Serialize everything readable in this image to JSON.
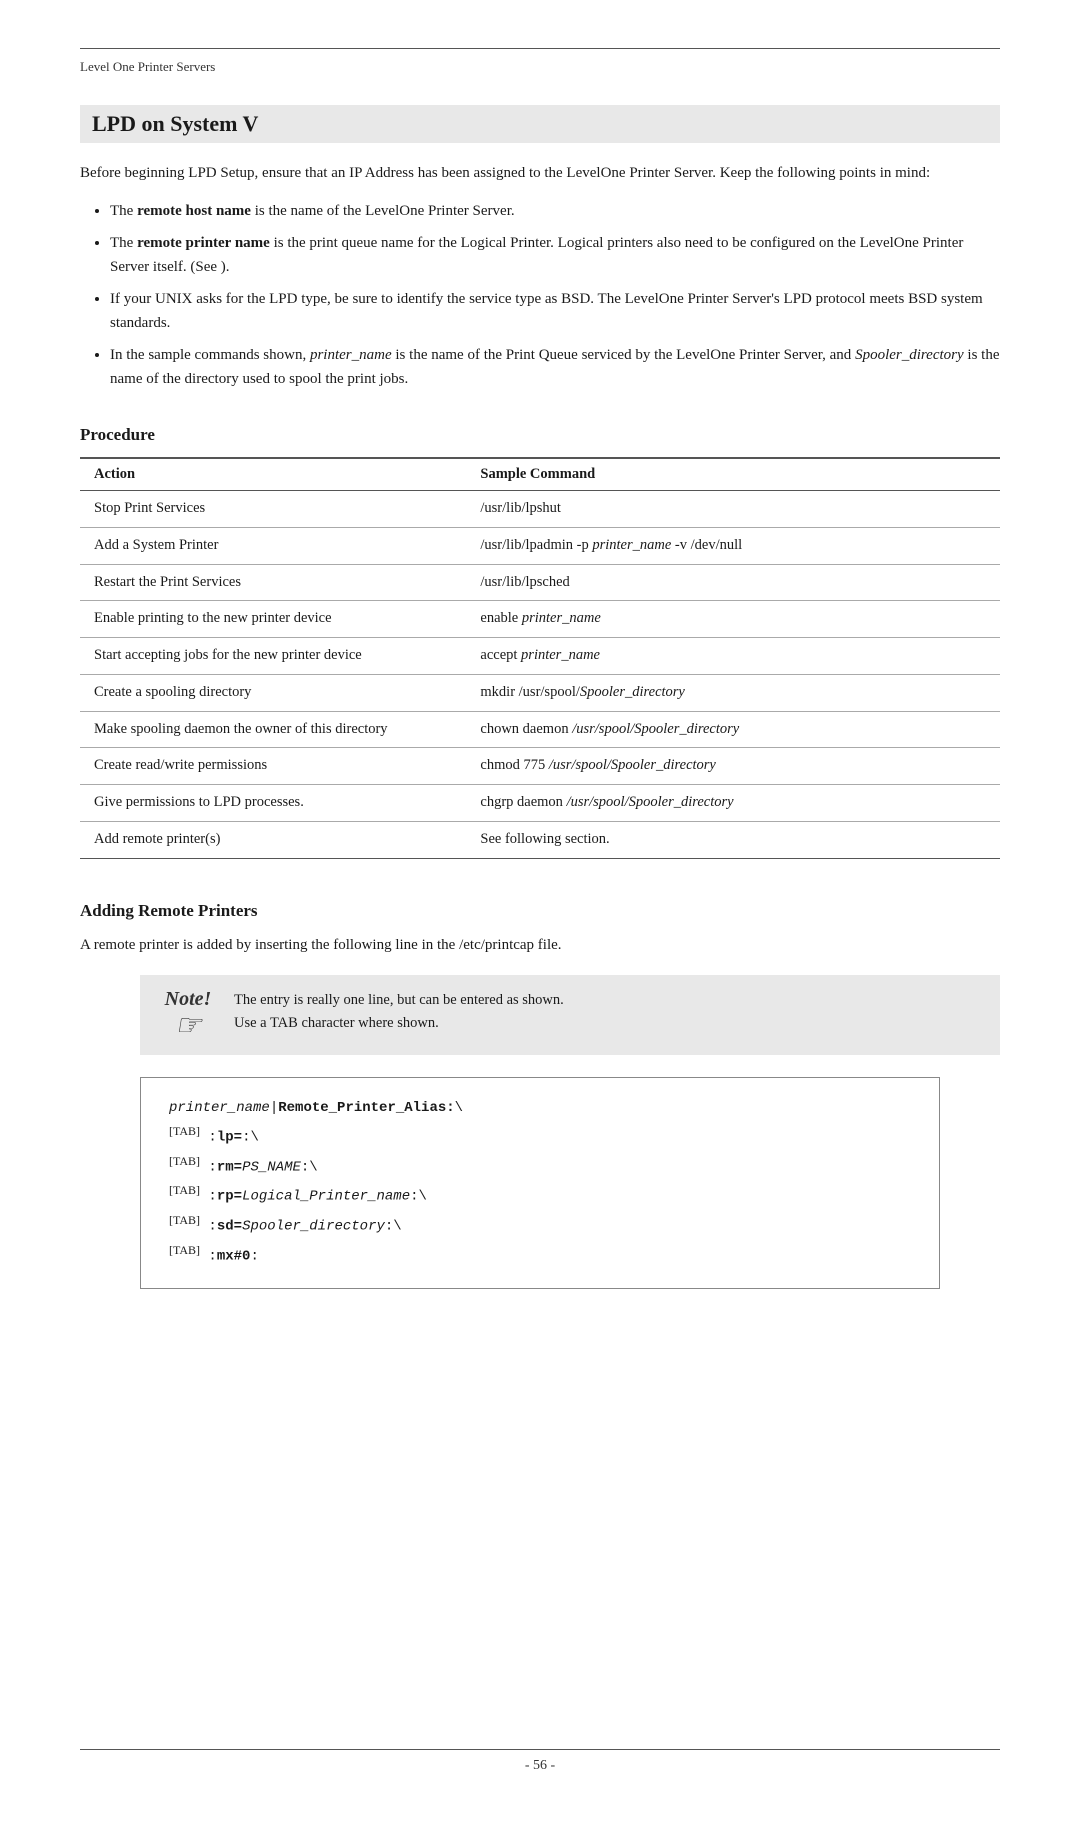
{
  "header": {
    "label": "Level One Printer Servers"
  },
  "section": {
    "title": "LPD on System V",
    "intro": "Before beginning LPD Setup, ensure that an IP Address has been assigned to the LevelOne Printer Server. Keep the following points in mind:",
    "bullets": [
      {
        "text": "The ",
        "bold": "remote host name",
        "rest": " is the name of the LevelOne Printer Server."
      },
      {
        "text": "The ",
        "bold": "remote printer name",
        "rest": " is the print queue name for the Logical Printer. Logical printers also need to be configured on the LevelOne Printer Server itself. (See )."
      },
      {
        "text": "If your UNIX asks for the LPD type, be sure to identify the service type as BSD. The LevelOne Printer Server's LPD protocol meets BSD system standards."
      },
      {
        "text": "In the sample commands shown, ",
        "italic": "printer_name",
        "mid": " is the name of the Print Queue serviced by the LevelOne Printer Server, and ",
        "italic2": "Spooler_directory",
        "rest": " is the name of the directory used to spool the print jobs."
      }
    ]
  },
  "procedure": {
    "title": "Procedure",
    "table": {
      "col1": "Action",
      "col2": "Sample Command",
      "rows": [
        {
          "action": "Stop Print Services",
          "command": "/usr/lib/lpshut",
          "cmd_italic": false
        },
        {
          "action": "Add a System Printer",
          "command": "/usr/lib/lpadmin -p ",
          "cmd_italic_part": "printer_name",
          "cmd_rest": " -v /dev/null",
          "cmd_italic": true
        },
        {
          "action": "Restart the Print Services",
          "command": "/usr/lib/lpsched",
          "cmd_italic": false
        },
        {
          "action": "Enable printing to the new printer device",
          "command": "enable ",
          "cmd_italic_part": "printer_name",
          "cmd_rest": "",
          "cmd_italic": true
        },
        {
          "action": "Start accepting jobs for the new printer device",
          "command": "accept ",
          "cmd_italic_part": "printer_name",
          "cmd_rest": "",
          "cmd_italic": true
        },
        {
          "action": "Create a spooling directory",
          "command": "mkdir /usr/spool/",
          "cmd_italic_part": "Spooler_directory",
          "cmd_rest": "",
          "cmd_italic": true
        },
        {
          "action": "Make spooling daemon the owner of this directory",
          "command": "chown daemon ",
          "cmd_italic_part": "/usr/spool/Spooler_directory",
          "cmd_rest": "",
          "cmd_italic": true
        },
        {
          "action": "Create read/write permissions",
          "command": "chmod 775 ",
          "cmd_italic_part": "/usr/spool/Spooler_directory",
          "cmd_rest": "",
          "cmd_italic": true
        },
        {
          "action": "Give permissions to LPD processes.",
          "command": "chgrp daemon ",
          "cmd_italic_part": "/usr/spool/Spooler_directory",
          "cmd_rest": "",
          "cmd_italic": true
        },
        {
          "action": "Add remote printer(s)",
          "command": "See following section.",
          "cmd_italic": false
        }
      ]
    }
  },
  "adding_remote": {
    "title": "Adding Remote Printers",
    "intro": "A remote printer is added by inserting the following line in the /etc/printcap file.",
    "note": {
      "label": "Note!",
      "text": "The entry is really one line, but can be entered as shown. Use a TAB character where shown."
    },
    "code": [
      {
        "text": "printer_name|Remote_Printer_Alias:\\",
        "bold_part": "Remote_Printer_Alias",
        "italic": true
      },
      {
        "tab": "[TAB]",
        "text": ":lp=:\\",
        "bold_part": "lp",
        "italic": false
      },
      {
        "tab": "[TAB]",
        "text": ":rm=PS_NAME:\\",
        "bold_part": "rm",
        "italic_part": "PS_NAME",
        "italic": true
      },
      {
        "tab": "[TAB]",
        "text": ":rp=Logical_Printer_name:\\",
        "bold_part": "rp",
        "italic_part": "Logical_Printer_name",
        "italic": true
      },
      {
        "tab": "[TAB]",
        "text": ":sd=Spooler_directory:\\",
        "bold_part": "sd",
        "italic_part": "Spooler_directory",
        "italic": true
      },
      {
        "tab": "[TAB]",
        "text": ":mx#0:",
        "bold_part": "mx",
        "italic": false
      }
    ]
  },
  "footer": {
    "page_number": "- 56 -"
  }
}
